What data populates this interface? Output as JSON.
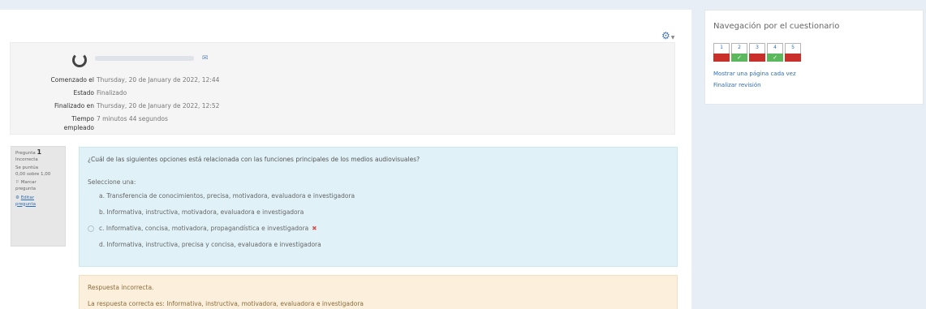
{
  "summary": {
    "rows": [
      {
        "label": "Comenzado el",
        "value": "Thursday, 20 de January de 2022, 12:44"
      },
      {
        "label": "Estado",
        "value": "Finalizado"
      },
      {
        "label": "Finalizado en",
        "value": "Thursday, 20 de January de 2022, 12:52"
      },
      {
        "label": "Tiempo",
        "value": "7 minutos 44 segundos"
      },
      {
        "label": "empleado",
        "value": ""
      }
    ]
  },
  "question_info": {
    "label": "Pregunta",
    "number": "1",
    "status": "Incorrecta",
    "mark_line1": "Se puntúa",
    "mark_line2": "0,00 sobre 1,00",
    "flag_line1": "Marcar",
    "flag_line2": "pregunta",
    "edit_line1": "Editar",
    "edit_line2": "pregunta"
  },
  "question": {
    "text": "¿Cuál de las siguientes opciones está relacionada con las funciones principales de los medios audiovisuales?",
    "prompt": "Seleccione una:",
    "options": [
      {
        "text": "a. Transferencia de conocimientos, precisa, motivadora, evaluadora e investigadora",
        "selected": false,
        "wrong": false
      },
      {
        "text": "b. Informativa, instructiva, motivadora, evaluadora e investigadora",
        "selected": false,
        "wrong": false
      },
      {
        "text": "c. Informativa, concisa, motivadora, propagandística e investigadora",
        "selected": true,
        "wrong": true
      },
      {
        "text": "d. Informativa, instructiva, precisa y concisa, evaluadora e investigadora",
        "selected": false,
        "wrong": false
      }
    ]
  },
  "feedback": {
    "status": "Respuesta incorrecta.",
    "correct": "La respuesta correcta es: Informativa, instructiva, motivadora, evaluadora e investigadora"
  },
  "nav": {
    "title": "Navegación por el cuestionario",
    "buttons": [
      {
        "num": "1",
        "state": "wrong"
      },
      {
        "num": "2",
        "state": "right"
      },
      {
        "num": "3",
        "state": "wrong"
      },
      {
        "num": "4",
        "state": "right"
      },
      {
        "num": "5",
        "state": "wrong"
      }
    ],
    "show_one_page": "Mostrar una página cada vez",
    "finish_review": "Finalizar revisión"
  },
  "icons": {
    "gear": "gear-icon",
    "message": "message-icon",
    "avatar": "avatar",
    "flag": "flag-icon",
    "edit": "gear-icon",
    "incorrect_mark": "close-icon"
  },
  "colors": {
    "accent": "#2c6eb8",
    "wrong": "#c9302c",
    "right": "#5cb85c",
    "question_bg": "#e0f1f7",
    "feedback_bg": "#fcefdc"
  }
}
